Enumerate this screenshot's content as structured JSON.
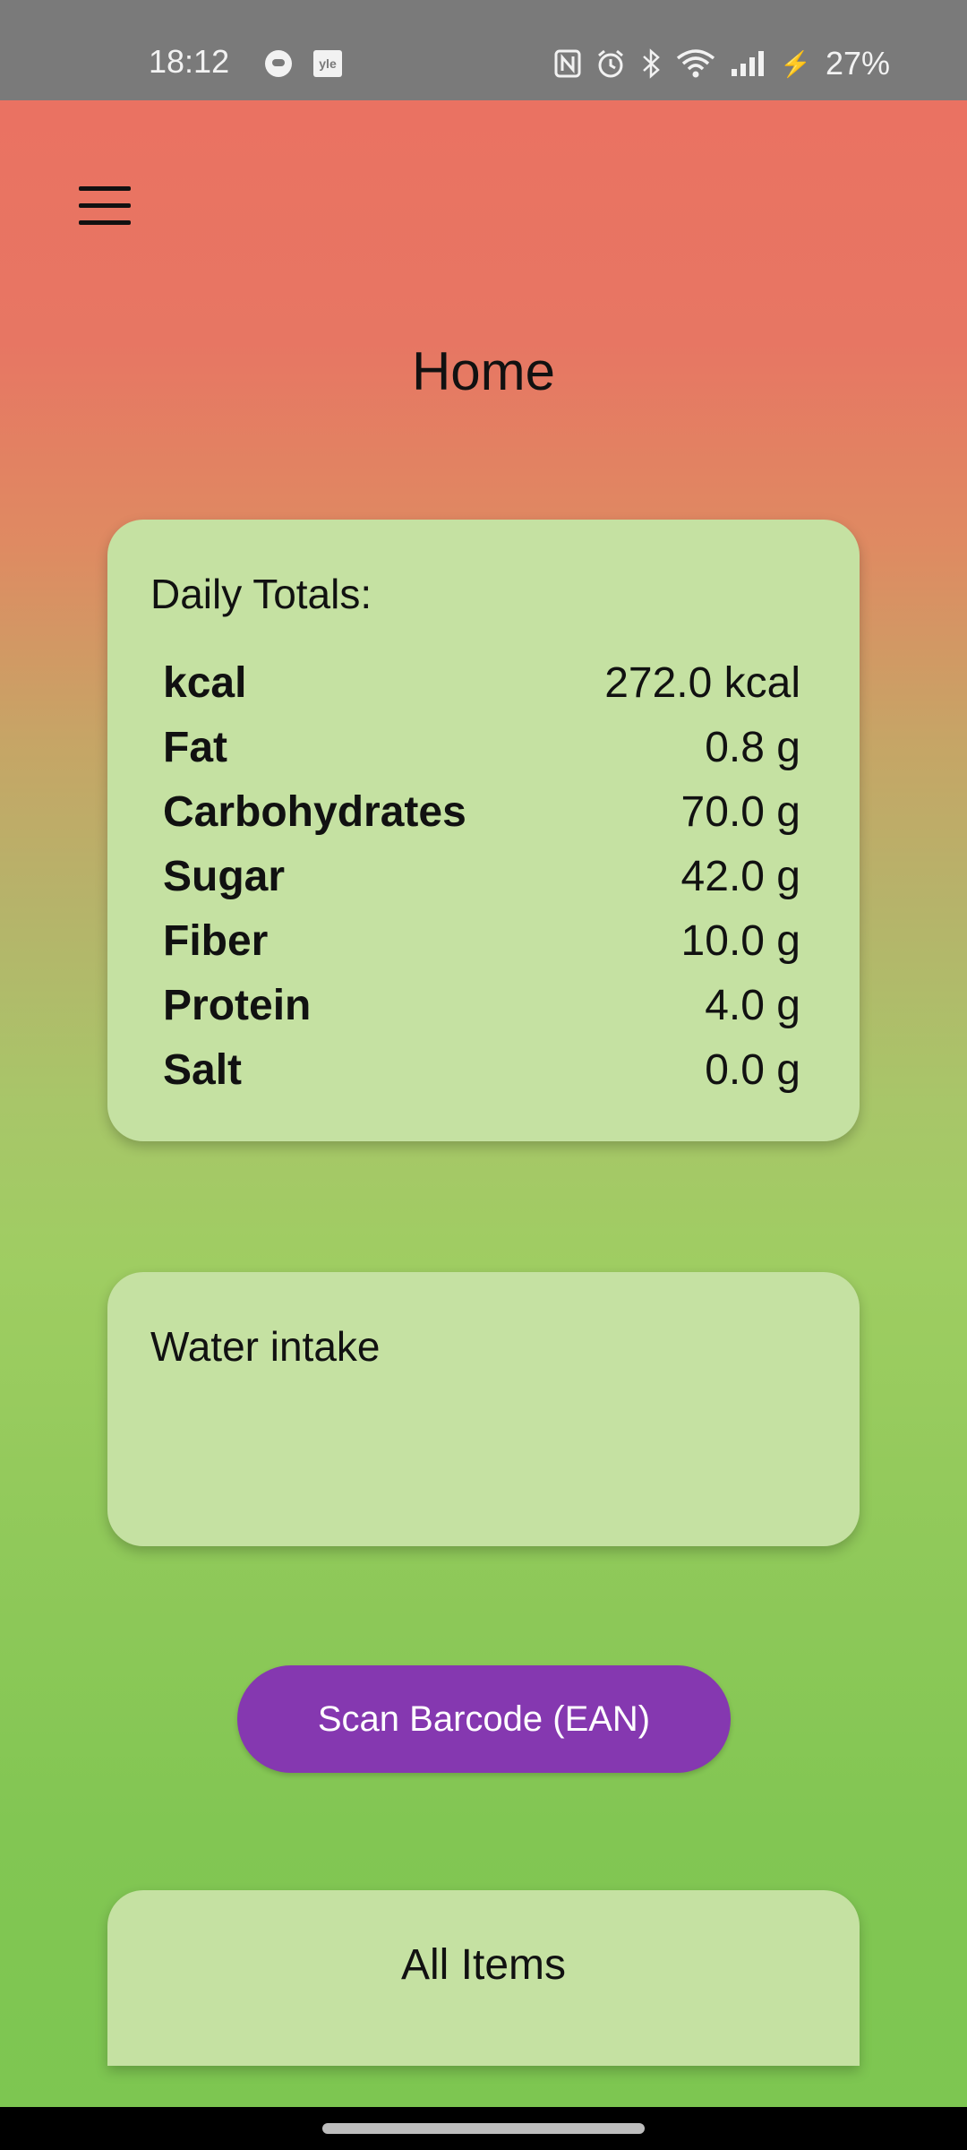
{
  "status_bar": {
    "time": "18:12",
    "left_icons": [
      "app-notification-icon",
      "yle-icon"
    ],
    "yle_label": "yle",
    "right_icons": [
      "nfc-icon",
      "alarm-icon",
      "bluetooth-icon",
      "wifi-icon",
      "signal-icon",
      "charging-icon"
    ],
    "battery": "27%"
  },
  "header": {
    "menu_icon": "hamburger-menu-icon",
    "title": "Home"
  },
  "totals": {
    "heading": "Daily Totals:",
    "rows": [
      {
        "name": "kcal",
        "value": "272.0 kcal"
      },
      {
        "name": "Fat",
        "value": "0.8 g"
      },
      {
        "name": "Carbohydrates",
        "value": "70.0 g"
      },
      {
        "name": "Sugar",
        "value": "42.0 g"
      },
      {
        "name": "Fiber",
        "value": "10.0 g"
      },
      {
        "name": "Protein",
        "value": "4.0 g"
      },
      {
        "name": "Salt",
        "value": "0.0 g"
      }
    ]
  },
  "water": {
    "heading": "Water intake"
  },
  "scan_button": {
    "label": "Scan Barcode (EAN)"
  },
  "items": {
    "title": "All Items"
  },
  "colors": {
    "gradient_top": "#ea7262",
    "gradient_bottom": "#7dc651",
    "card": "#c5e1a2",
    "button": "#8538b0",
    "status_bar": "#7a7a7a"
  }
}
